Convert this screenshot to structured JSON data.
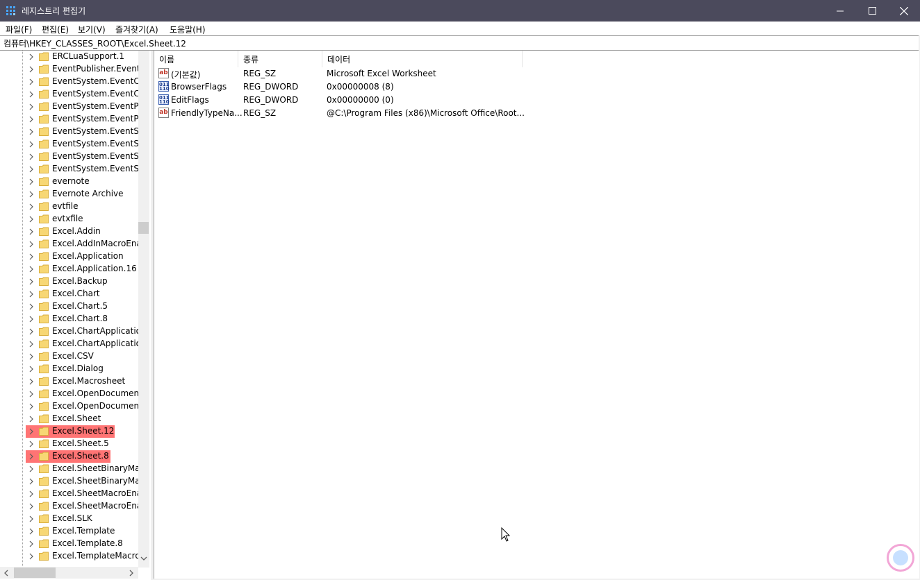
{
  "window": {
    "title": "레지스트리 편집기",
    "controls": [
      "minimize",
      "maximize",
      "close"
    ]
  },
  "menu": [
    "파일(F)",
    "편집(E)",
    "보기(V)",
    "즐겨찾기(A)",
    "도움말(H)"
  ],
  "address": "컴퓨터\\HKEY_CLASSES_ROOT\\Excel.Sheet.12",
  "tree": {
    "items": [
      "ERCLuaSupport.1",
      "EventPublisher.EventPu",
      "EventSystem.EventClas",
      "EventSystem.EventClas",
      "EventSystem.EventPubl",
      "EventSystem.EventPubl",
      "EventSystem.EventSubs",
      "EventSystem.EventSubs",
      "EventSystem.EventSyste",
      "EventSystem.EventSyste",
      "evernote",
      "Evernote Archive",
      "evtfile",
      "evtxfile",
      "Excel.Addin",
      "Excel.AddInMacroEnab",
      "Excel.Application",
      "Excel.Application.16",
      "Excel.Backup",
      "Excel.Chart",
      "Excel.Chart.5",
      "Excel.Chart.8",
      "Excel.ChartApplication",
      "Excel.ChartApplication.",
      "Excel.CSV",
      "Excel.Dialog",
      "Excel.Macrosheet",
      "Excel.OpenDocumentS",
      "Excel.OpenDocumentS",
      "Excel.Sheet",
      "Excel.Sheet.12",
      "Excel.Sheet.5",
      "Excel.Sheet.8",
      "Excel.SheetBinaryMacro",
      "Excel.SheetBinaryMacro",
      "Excel.SheetMacroEnabl",
      "Excel.SheetMacroEnabl",
      "Excel.SLK",
      "Excel.Template",
      "Excel.Template.8",
      "Excel.TemplateMacroEr"
    ],
    "highlighted": [
      "Excel.Sheet.12",
      "Excel.Sheet.8"
    ]
  },
  "values": {
    "columns": [
      "이름",
      "종류",
      "데이터"
    ],
    "rows": [
      {
        "icon": "string-value-icon",
        "name": "(기본값)",
        "type": "REG_SZ",
        "data": "Microsoft Excel Worksheet"
      },
      {
        "icon": "binary-value-icon",
        "name": "BrowserFlags",
        "type": "REG_DWORD",
        "data": "0x00000008 (8)"
      },
      {
        "icon": "binary-value-icon",
        "name": "EditFlags",
        "type": "REG_DWORD",
        "data": "0x00000000 (0)"
      },
      {
        "icon": "string-value-icon",
        "name": "FriendlyTypeNa...",
        "type": "REG_SZ",
        "data": "@C:\\Program Files (x86)\\Microsoft Office\\Root..."
      }
    ]
  },
  "colors": {
    "titlebar": "#4b4a5c",
    "highlight": "#ff4646",
    "folder": "#f7d774"
  }
}
